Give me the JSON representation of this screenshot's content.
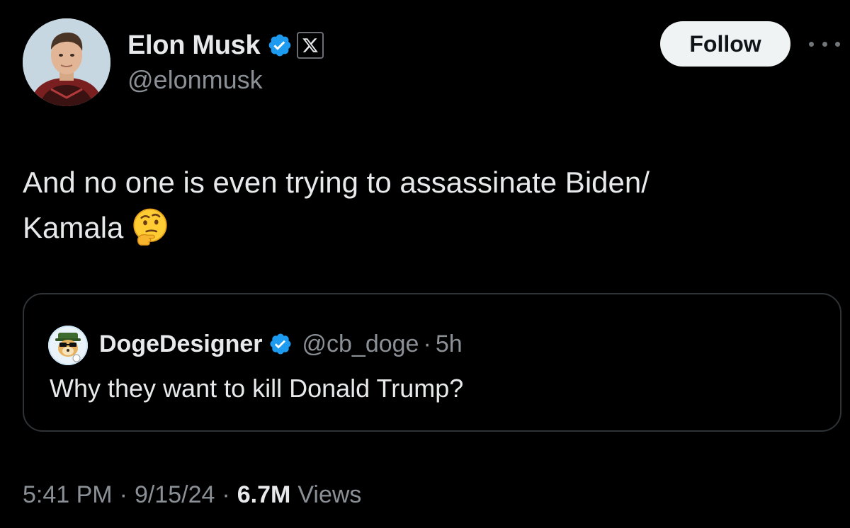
{
  "author": {
    "display_name": "Elon Musk",
    "handle": "@elonmusk",
    "verified": true,
    "affiliation_icon": "x-logo-icon",
    "avatar_icon": "profile-photo"
  },
  "actions": {
    "follow_label": "Follow",
    "more_icon": "more-options-icon"
  },
  "tweet": {
    "text_line1": "And no one is even trying to assassinate Biden/",
    "text_line2": "Kamala",
    "emoji": "thinking-face-emoji"
  },
  "quoted": {
    "display_name": "DogeDesigner",
    "handle": "@cb_doge",
    "separator": "·",
    "time": "5h",
    "verified": true,
    "text": "Why they want to kill Donald Trump?"
  },
  "meta": {
    "time": "5:41 PM",
    "separator": "·",
    "date": "9/15/24",
    "views_count": "6.7M",
    "views_label": "Views"
  },
  "colors": {
    "background": "#000000",
    "text_primary": "#e7e9ea",
    "text_secondary": "#8b9096",
    "verified_blue": "#1d9bf0",
    "follow_bg": "#eff3f4",
    "border": "#2f3336"
  }
}
